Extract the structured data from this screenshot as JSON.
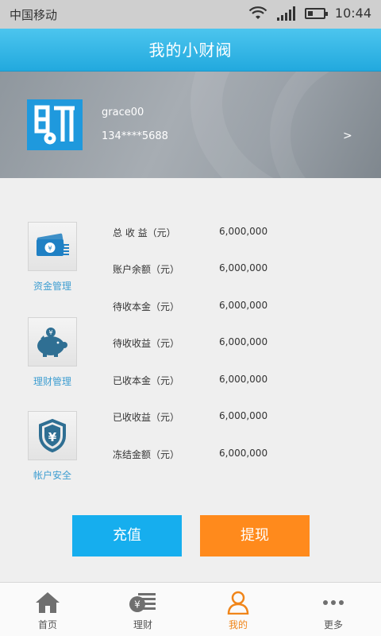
{
  "status_bar": {
    "carrier": "中国移动",
    "time": "10:44"
  },
  "header": {
    "title": "我的小财阀"
  },
  "profile": {
    "username": "grace00",
    "phone": "134****5688",
    "chevron": ">"
  },
  "menu": [
    {
      "label": "资金管理",
      "icon": "money-icon"
    },
    {
      "label": "理财管理",
      "icon": "piggy-bank-icon"
    },
    {
      "label": "帐户安全",
      "icon": "shield-yen-icon"
    }
  ],
  "stats": [
    {
      "label": "总 收  益（元）",
      "value": "6,000,000"
    },
    {
      "label": "账户余额（元）",
      "value": "6,000,000"
    },
    {
      "label": "待收本金（元）",
      "value": "6,000,000"
    },
    {
      "label": "待收收益（元）",
      "value": "6,000,000"
    },
    {
      "label": "已收本金（元）",
      "value": "6,000,000"
    },
    {
      "label": "已收收益（元）",
      "value": "6,000,000"
    },
    {
      "label": "冻结金额（元）",
      "value": "6,000,000"
    }
  ],
  "actions": {
    "recharge": "充值",
    "withdraw": "提现"
  },
  "tabs": [
    {
      "label": "首页",
      "icon": "home-icon"
    },
    {
      "label": "理财",
      "icon": "finance-icon"
    },
    {
      "label": "我的",
      "icon": "user-icon",
      "active": true
    },
    {
      "label": "更多",
      "icon": "more-icon"
    }
  ],
  "colors": {
    "accent_blue": "#22a9de",
    "button_blue": "#16aeee",
    "button_orange": "#ff8a1c",
    "active_tab": "#f08519"
  }
}
